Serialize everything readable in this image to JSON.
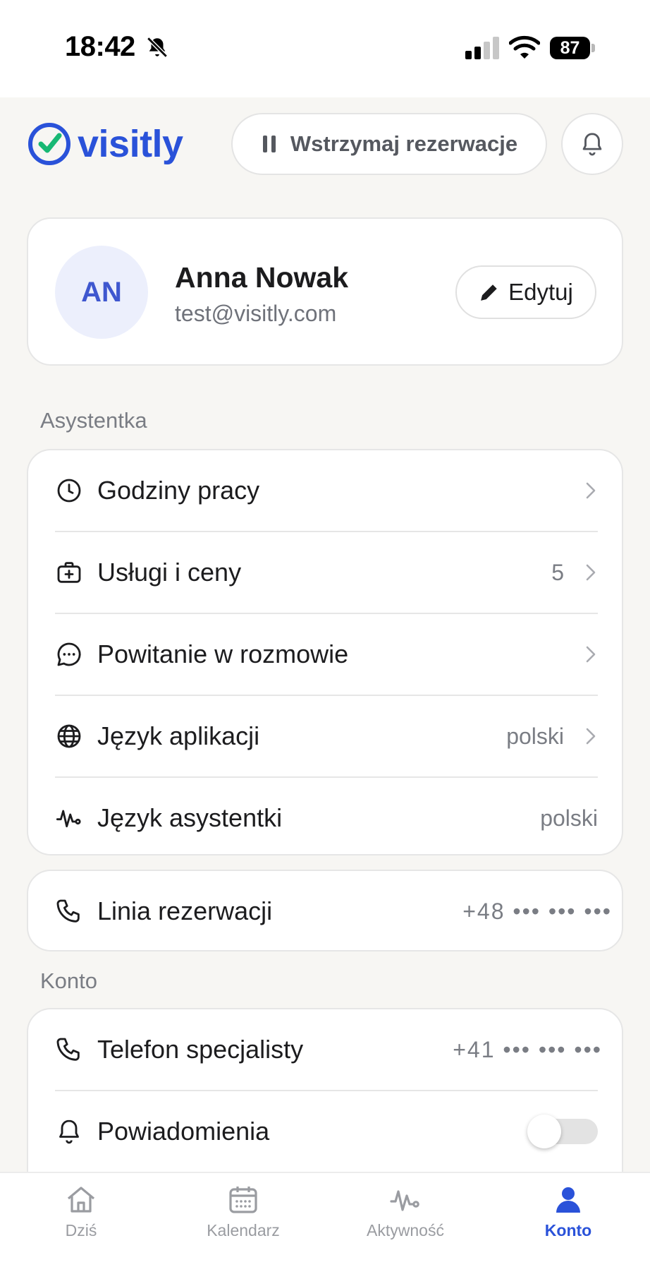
{
  "status_bar": {
    "time": "18:42",
    "battery": "87"
  },
  "brand": {
    "name": "visitly"
  },
  "header": {
    "pause_label": "Wstrzymaj rezerwacje"
  },
  "profile": {
    "initials": "AN",
    "name": "Anna Nowak",
    "email": "test@visitly.com",
    "edit_label": "Edytuj"
  },
  "sections": {
    "assistant": {
      "label": "Asystentka",
      "items": [
        {
          "label": "Godziny pracy",
          "value": ""
        },
        {
          "label": "Usługi i ceny",
          "value": "5"
        },
        {
          "label": "Powitanie w rozmowie",
          "value": ""
        },
        {
          "label": "Język aplikacji",
          "value": "polski"
        },
        {
          "label": "Język asystentki",
          "value": "polski"
        }
      ]
    },
    "booking_line": {
      "label": "Linia rezerwacji",
      "value": "+48 ••• ••• •••"
    },
    "account": {
      "label": "Konto",
      "items": [
        {
          "label": "Telefon specjalisty",
          "value": "+41 ••• ••• •••"
        },
        {
          "label": "Powiadomienia",
          "toggle_on": false
        }
      ]
    }
  },
  "tabs": [
    {
      "label": "Dziś",
      "icon": "home-icon",
      "active": false
    },
    {
      "label": "Kalendarz",
      "icon": "calendar-icon",
      "active": false
    },
    {
      "label": "Aktywność",
      "icon": "activity-icon",
      "active": false
    },
    {
      "label": "Konto",
      "icon": "person-icon",
      "active": true
    }
  ],
  "colors": {
    "accent": "#2a52d9",
    "check": "#18b874",
    "background": "#f7f6f3"
  }
}
